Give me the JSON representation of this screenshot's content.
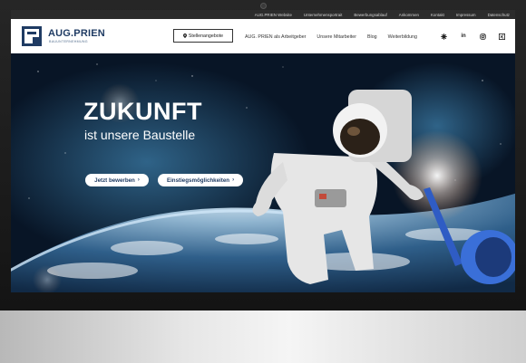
{
  "topbar": {
    "links": [
      "AUG.PRIEN Website",
      "Unternehmensportrait",
      "Bewerbungsablauf",
      "Ankommen",
      "Kontakt",
      "Impressum",
      "Datenschutz"
    ]
  },
  "header": {
    "logo_name": "AUG.PRIEN",
    "logo_sub": "BAUUNTERNEHMUNG",
    "jobs_label": "Stellenangebote",
    "menu": [
      "AUG. PRIEN als Arbeitgeber",
      "Unsere Mitarbeiter",
      "Blog",
      "Weiterbildung"
    ],
    "social": [
      "kununu-icon",
      "linkedin-icon",
      "instagram-icon",
      "xing-icon"
    ]
  },
  "hero": {
    "title": "ZUKUNFT",
    "subtitle": "ist unsere Baustelle",
    "cta_primary": "Jetzt bewerben",
    "cta_secondary": "Einstiegsmöglichkeiten"
  },
  "colors": {
    "brand": "#1f3b63",
    "topbar": "#2c2c2c",
    "bezel": "#1a1a1a"
  }
}
